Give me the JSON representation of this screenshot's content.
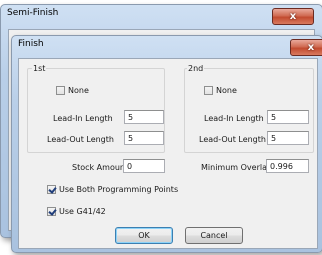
{
  "semi_finish": {
    "title": "Semi-Finish",
    "close_label": "x"
  },
  "finish": {
    "title": "Finish",
    "close_label": "x",
    "group1": {
      "label": "1st",
      "none_label": "None",
      "none_checked": false,
      "lead_in_label": "Lead-In Length",
      "lead_in_value": "5",
      "lead_out_label": "Lead-Out Length",
      "lead_out_value": "5"
    },
    "group2": {
      "label": "2nd",
      "none_label": "None",
      "none_checked": false,
      "lead_in_label": "Lead-In Length",
      "lead_in_value": "5",
      "lead_out_label": "Lead-Out Length",
      "lead_out_value": "5"
    },
    "stock_amount_label": "Stock Amount",
    "stock_amount_value": "0",
    "min_overlap_label": "Minimum Overlap",
    "min_overlap_value": "0.996",
    "use_both_label": "Use Both Programming Points",
    "use_both_checked": true,
    "use_g41_label": "Use G41/42",
    "use_g41_checked": true,
    "ok_label": "OK",
    "cancel_label": "Cancel"
  }
}
